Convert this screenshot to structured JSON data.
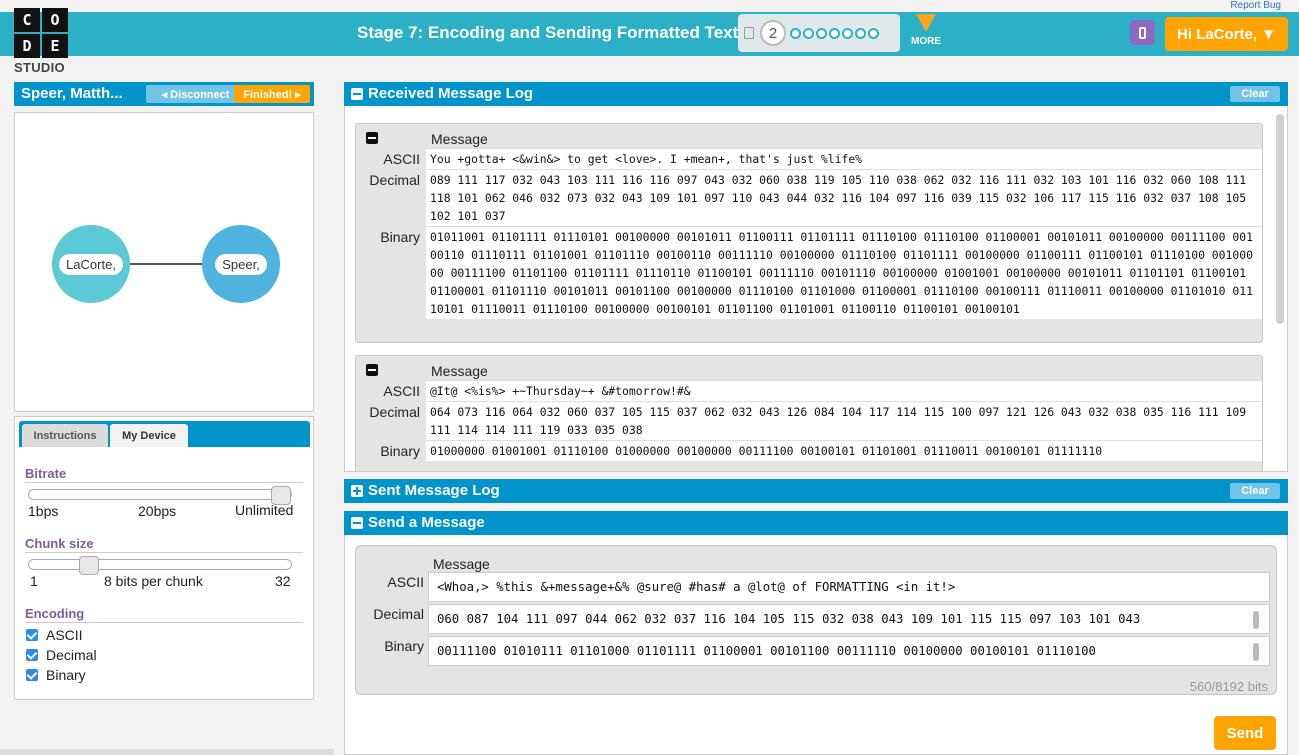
{
  "header": {
    "report_bug": "Report Bug",
    "logo_letters": [
      "C",
      "O",
      "D",
      "E"
    ],
    "logo_studio": "STUDIO",
    "stage_title": "Stage 7: Encoding and Sending Formatted Text",
    "current_level": "2",
    "more_label": "MORE",
    "greeting": "Hi LaCorte, ▼",
    "colors": {
      "bar": "#2bb0c5",
      "accent": "#ffa400"
    }
  },
  "peer": {
    "name": "Speer, Matth...",
    "disconnect_label": "◂ Disconnect",
    "finished_label": "Finished! ▸"
  },
  "network": {
    "node_a": "LaCorte,",
    "node_b": "Speer,"
  },
  "tabs": {
    "instructions": "Instructions",
    "my_device": "My Device"
  },
  "device": {
    "bitrate_label": "Bitrate",
    "bitrate_min": "1bps",
    "bitrate_value": "20bps",
    "bitrate_max": "Unlimited",
    "chunk_label": "Chunk size",
    "chunk_min": "1",
    "chunk_value": "8 bits per chunk",
    "chunk_max": "32",
    "encoding_label": "Encoding",
    "encodings": [
      "ASCII",
      "Decimal",
      "Binary"
    ]
  },
  "received_log": {
    "title": "Received Message Log",
    "clear": "Clear",
    "row_labels": {
      "message": "Message",
      "ascii": "ASCII",
      "decimal": "Decimal",
      "binary": "Binary"
    },
    "messages": [
      {
        "ascii": "You +gotta+ <&win&> to get <love>. I +mean+, that's just %life%",
        "decimal": "089 111 117 032 043 103 111 116 116 097 043 032 060 038 119 105 110 038 062 032 116 111 032 103 101 116 032 060 108 111 118 101 062 046 032 073 032 043 109 101 097 110 043 044 032 116 104 097 116 039 115 032 106 117 115 116 032 037 108 105 102 101 037",
        "binary": "01011001 01101111 01110101 00100000 00101011 01100111 01101111 01110100 01110100 01100001 00101011 00100000 00111100 00100110 01110111 01101001 01101110 00100110 00111110 00100000 01110100 01101111 00100000 01100111 01100101 01110100 00100000 00111100 01101100 01101111 01110110 01100101 00111110 00101110 00100000 01001001 00100000 00101011 01101101 01100101 01100001 01101110 00101011 00101100 00100000 01110100 01101000 01100001 01110100 00100111 01110011 00100000 01101010 01110101 01110011 01110100 00100000 00100101 01101100 01101001 01100110 01100101 00100101"
      },
      {
        "ascii": "@It@ <%is%> +~Thursday~+ &#tomorrow!#&",
        "decimal": "064 073 116 064 032 060 037 105 115 037 062 032 043 126 084 104 117 114 115 100 097 121 126 043 032 038 035 116 111 109 111 114 114 111 119 033 035 038",
        "binary": "01000000 01001001 01110100 01000000 00100000 00111100 00100101 01101001 01110011 00100101 01111110"
      }
    ]
  },
  "sent_log": {
    "title": "Sent Message Log",
    "clear": "Clear"
  },
  "send": {
    "title": "Send a Message",
    "message_label": "Message",
    "ascii_label": "ASCII",
    "decimal_label": "Decimal",
    "binary_label": "Binary",
    "ascii_value": "<Whoa,> %this &+message+&% @sure@ #has# a @lot@ of FORMATTING <in it!>",
    "decimal_value": "060 087 104 111 097 044 062 032 037 116 104 105 115 032 038 043 109 101 115 115 097 103 101 043",
    "binary_value": "00111100 01010111 01101000 01101111 01100001 00101100 00111110 00100000 00100101 01110100",
    "bits_count": "560/8192 bits",
    "send_label": "Send"
  }
}
